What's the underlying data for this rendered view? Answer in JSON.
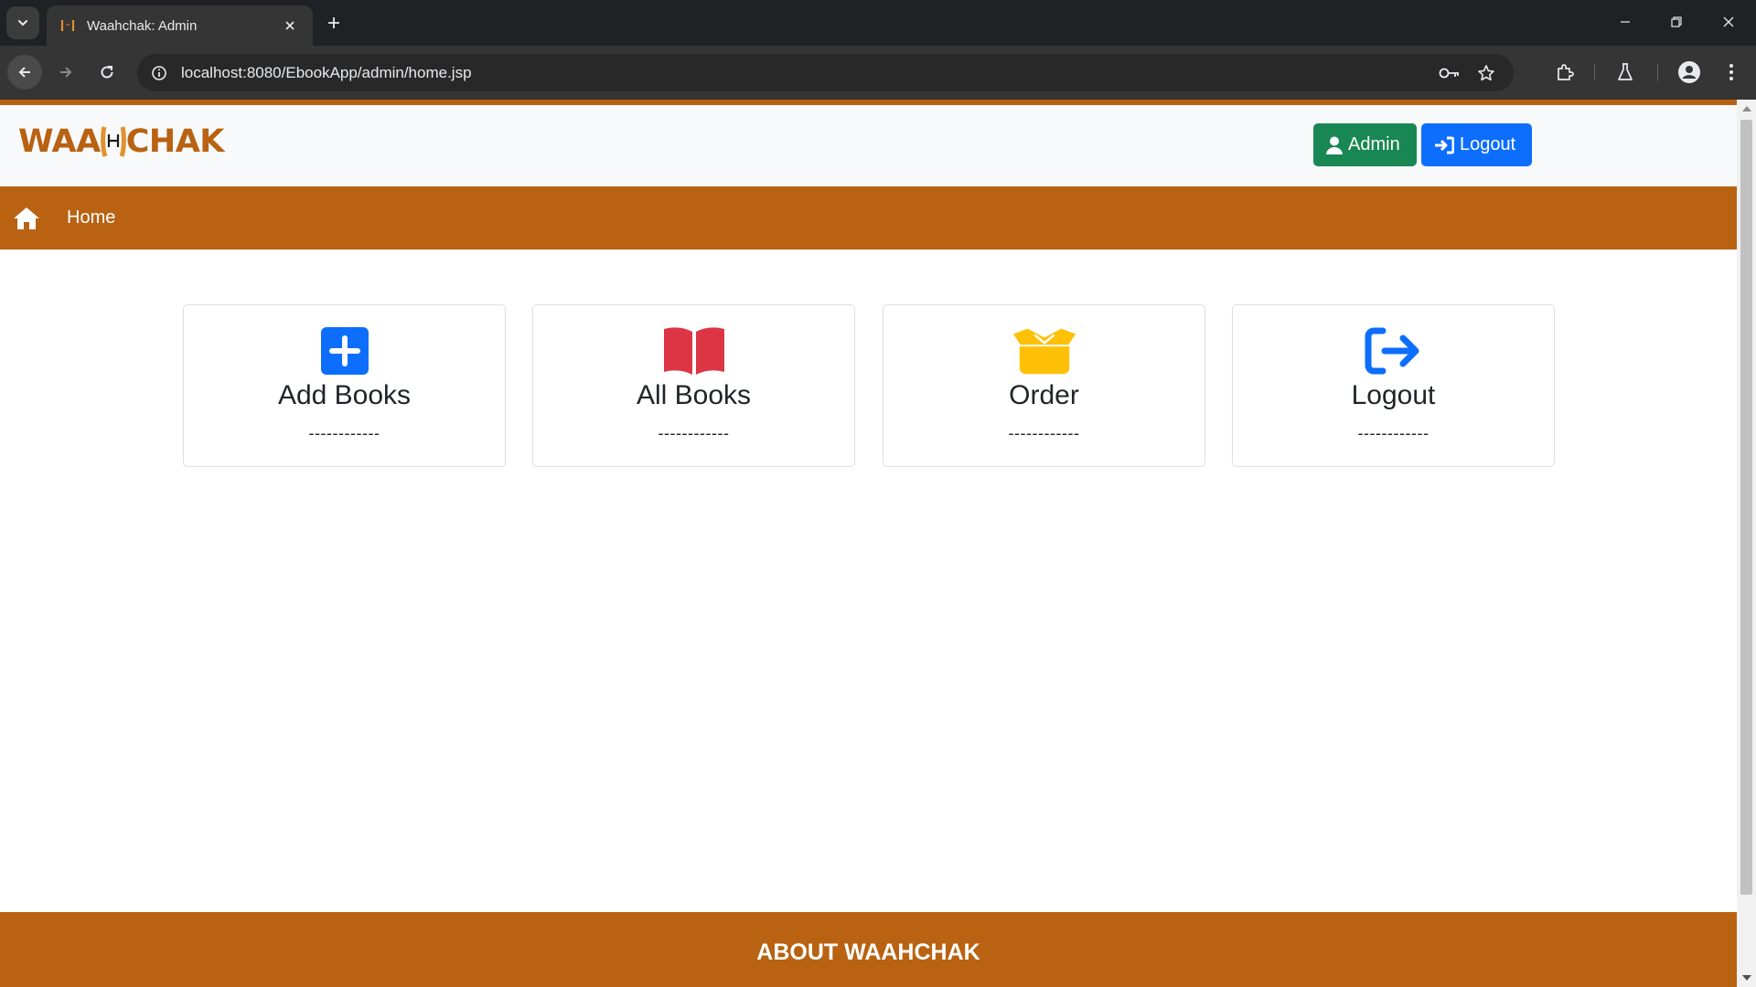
{
  "browser": {
    "tab_title": "Waahchak: Admin",
    "url": "localhost:8080/EbookApp/admin/home.jsp"
  },
  "site": {
    "logo": {
      "left": "WAA",
      "mid": "H",
      "right": "CHAK"
    },
    "header_buttons": {
      "admin": "Admin",
      "logout": "Logout"
    },
    "nav": {
      "home": "Home"
    },
    "cards": [
      {
        "title": "Add Books",
        "dashes": "------------",
        "icon": "plus-square-icon",
        "color": "#0d6efd"
      },
      {
        "title": "All Books",
        "dashes": "------------",
        "icon": "book-open-icon",
        "color": "#dc3545"
      },
      {
        "title": "Order",
        "dashes": "------------",
        "icon": "box-open-icon",
        "color": "#ffc107"
      },
      {
        "title": "Logout",
        "dashes": "------------",
        "icon": "logout-icon",
        "color": "#0d6efd"
      }
    ],
    "footer": {
      "title": "ABOUT WAAHCHAK"
    }
  },
  "colors": {
    "brand": "#b86212",
    "admin_button": "#198754",
    "logout_button": "#0d6efd"
  }
}
